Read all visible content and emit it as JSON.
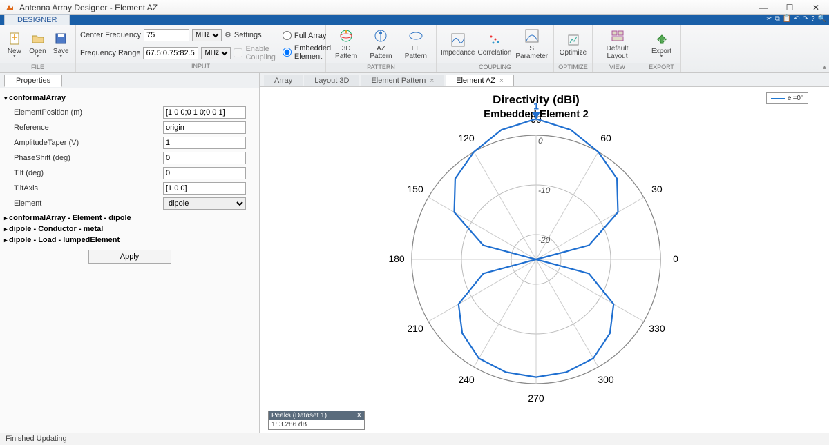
{
  "window": {
    "title": "Antenna Array Designer - Element AZ"
  },
  "ribbon": {
    "tab": "DESIGNER",
    "file": {
      "label": "FILE",
      "new": "New",
      "open": "Open",
      "save": "Save"
    },
    "input": {
      "label": "INPUT",
      "centerfreq_label": "Center Frequency",
      "centerfreq_value": "75",
      "centerfreq_unit": "MHz",
      "freqrange_label": "Frequency Range",
      "freqrange_value": "67.5:0.75:82.5",
      "freqrange_unit": "MHz",
      "settings": "Settings",
      "enable_coupling": "Enable Coupling",
      "full_array": "Full Array",
      "embedded_element": "Embedded Element"
    },
    "pattern": {
      "label": "PATTERN",
      "pat3d": "3D Pattern",
      "az": "AZ Pattern",
      "el": "EL Pattern"
    },
    "coupling": {
      "label": "COUPLING",
      "imp": "Impedance",
      "corr": "Correlation",
      "spar": "S Parameter"
    },
    "optimize": {
      "label": "OPTIMIZE",
      "btn": "Optimize"
    },
    "view": {
      "label": "VIEW",
      "btn": "Default Layout"
    },
    "export": {
      "label": "EXPORT",
      "btn": "Export"
    }
  },
  "left": {
    "tab": "Properties",
    "section1": "conformalArray",
    "rows": {
      "elementPosition": {
        "label": "ElementPosition (m)",
        "value": "[1 0 0;0 1 0;0 0 1]"
      },
      "reference": {
        "label": "Reference",
        "value": "origin"
      },
      "amplitudeTaper": {
        "label": "AmplitudeTaper (V)",
        "value": "1"
      },
      "phaseShift": {
        "label": "PhaseShift (deg)",
        "value": "0"
      },
      "tilt": {
        "label": "Tilt (deg)",
        "value": "0"
      },
      "tiltAxis": {
        "label": "TiltAxis",
        "value": "[1 0 0]"
      },
      "element": {
        "label": "Element",
        "value": "dipole"
      }
    },
    "section2": "conformalArray - Element - dipole",
    "section3": "dipole - Conductor - metal",
    "section4": "dipole - Load - lumpedElement",
    "apply": "Apply"
  },
  "right": {
    "tabs": {
      "array": "Array",
      "layout3d": "Layout 3D",
      "elementPattern": "Element Pattern",
      "elementAZ": "Element AZ"
    }
  },
  "chart": {
    "title": "Directivity (dBi)",
    "subtitle": "Embedded Element 2",
    "legend": "el=0°",
    "peak_marker": "1"
  },
  "chart_data": {
    "type": "polar",
    "title": "Directivity (dBi)",
    "subtitle": "Embedded Element 2",
    "angle_unit": "deg",
    "angle_labels": [
      0,
      30,
      60,
      90,
      120,
      150,
      180,
      210,
      240,
      270,
      300,
      330
    ],
    "radial_labels": [
      0,
      -10,
      -20
    ],
    "radial_range_dBi": [
      -25,
      0
    ],
    "series": [
      {
        "name": "el=0°",
        "angle_deg": [
          0,
          15,
          30,
          45,
          60,
          75,
          90,
          105,
          120,
          135,
          150,
          165,
          180,
          195,
          210,
          225,
          240,
          255,
          270,
          285,
          300,
          315,
          330,
          345
        ],
        "value_dBi": [
          -25,
          -14,
          -6,
          -2,
          0,
          2,
          3.286,
          2,
          0,
          -2,
          -6,
          -14,
          -25,
          -14,
          -7,
          -4,
          -2,
          -1.5,
          -1.3,
          -1.5,
          -2,
          -4,
          -7,
          -14
        ]
      }
    ],
    "peaks": [
      {
        "index": 1,
        "angle_deg": 90,
        "value_dBi": 3.286
      }
    ]
  },
  "peaks": {
    "header": "Peaks (Dataset 1)",
    "row": "1: 3.286 dB"
  },
  "status": "Finished Updating"
}
